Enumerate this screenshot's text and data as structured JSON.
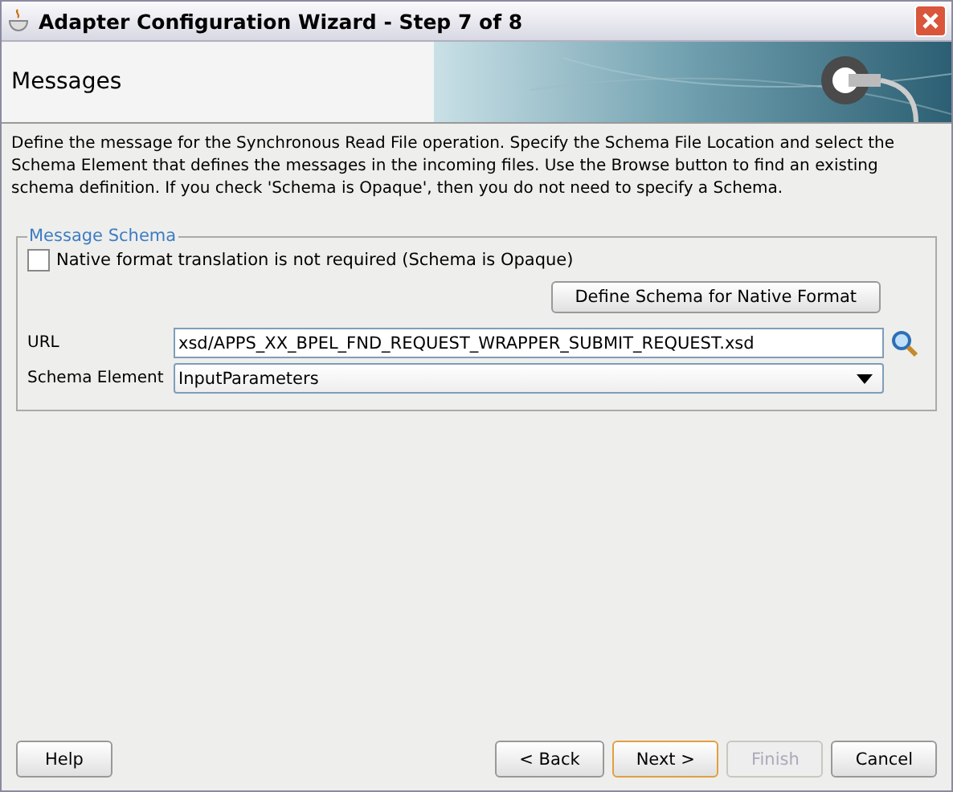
{
  "window": {
    "title": "Adapter Configuration Wizard - Step 7 of 8"
  },
  "header": {
    "title": "Messages"
  },
  "description": "Define the message for the Synchronous Read File operation.  Specify the Schema File Location and select the Schema Element that defines the messages in the incoming files. Use the Browse button to find an existing schema definition. If you check 'Schema is Opaque', then you do not need to specify a Schema.",
  "group": {
    "title": "Message Schema",
    "checkbox": {
      "label": "Native format translation is not required (Schema is Opaque)",
      "checked": false
    },
    "define_button": "Define Schema for Native Format",
    "url": {
      "label": "URL",
      "value": "xsd/APPS_XX_BPEL_FND_REQUEST_WRAPPER_SUBMIT_REQUEST.xsd"
    },
    "schema_element": {
      "label": "Schema Element",
      "value": "InputParameters"
    }
  },
  "help_button": {
    "label": "Help",
    "disabled": false,
    "default": false
  },
  "buttons": [
    {
      "label": "< Back",
      "disabled": false,
      "default": false
    },
    {
      "label": "Next >",
      "disabled": false,
      "default": true
    },
    {
      "label": "Finish",
      "disabled": true,
      "default": false
    },
    {
      "label": "Cancel",
      "disabled": false,
      "default": false
    }
  ]
}
